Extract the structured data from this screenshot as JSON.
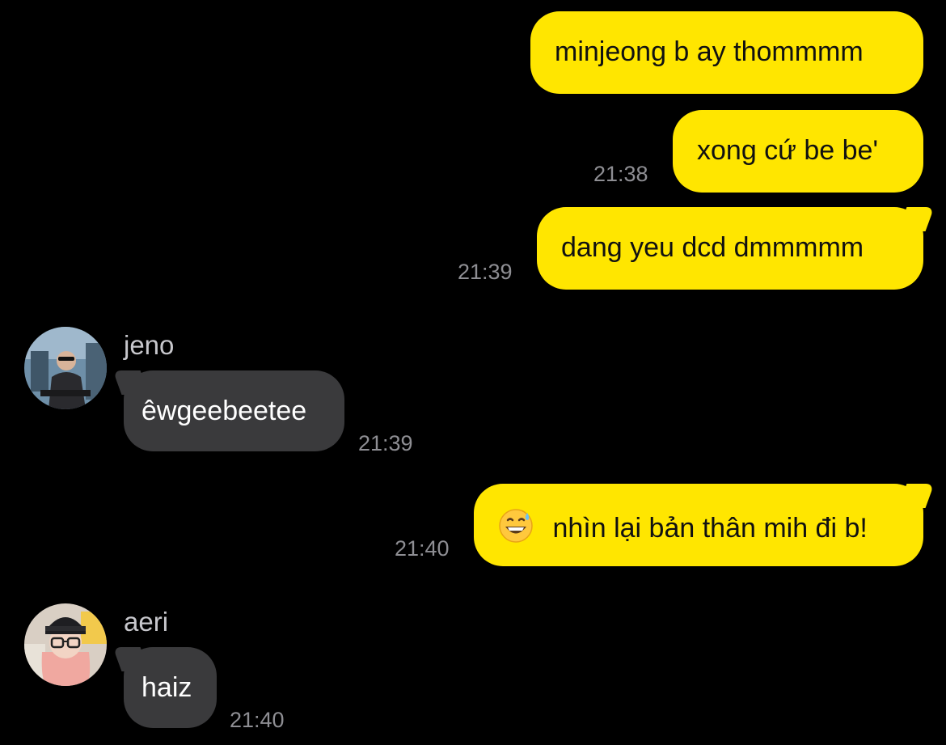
{
  "colors": {
    "background": "#000000",
    "outgoing_bubble": "#FFE600",
    "incoming_bubble": "#3A3A3C",
    "timestamp": "#8E8E93"
  },
  "messages": [
    {
      "direction": "outgoing",
      "text": "minjeong b ay thommmm",
      "time": ""
    },
    {
      "direction": "outgoing",
      "text": "xong cứ be be'",
      "time": "21:38"
    },
    {
      "direction": "outgoing",
      "text": "dang yeu dcd dmmmmm",
      "time": "21:39"
    },
    {
      "direction": "incoming",
      "sender": "jeno",
      "avatar_icon": "jeno-avatar",
      "text": "êwgeebeetee",
      "time": "21:39"
    },
    {
      "direction": "outgoing",
      "emoji": "grinning-face-with-sweat-emoji",
      "text": "nhìn lại bản thân mih đi b!",
      "time": "21:40"
    },
    {
      "direction": "incoming",
      "sender": "aeri",
      "avatar_icon": "aeri-avatar",
      "text": "haiz",
      "time": "21:40"
    }
  ]
}
